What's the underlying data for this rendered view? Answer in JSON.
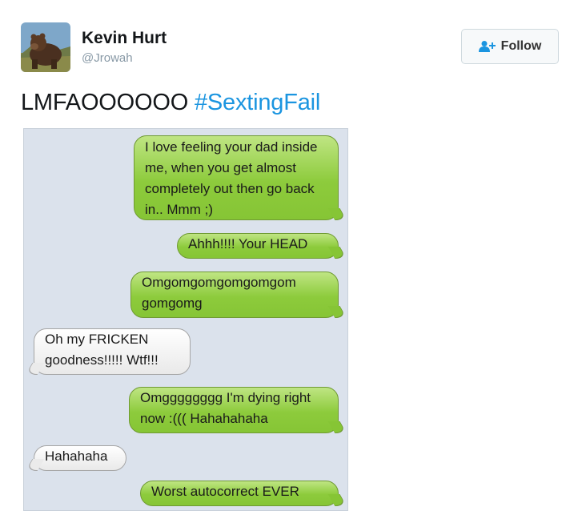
{
  "user": {
    "name": "Kevin Hurt",
    "handle": "@Jrowah",
    "avatar_icon": "bear-photo"
  },
  "follow_button": {
    "label": "Follow",
    "icon": "add-user-icon"
  },
  "tweet": {
    "text": "LMFAOOOOOO ",
    "hashtag": "#SextingFail"
  },
  "colors": {
    "hashtag": "#1b95e0",
    "outgoing_bubble": "#8dcb3c",
    "incoming_bubble": "#ffffff",
    "conversation_bg": "#dbe2ec"
  },
  "messages": [
    {
      "direction": "outgoing",
      "text": "I love feeling your dad inside me, when you get almost completely out then go back in.. Mmm ;)"
    },
    {
      "direction": "outgoing",
      "text": "Ahhh!!!! Your HEAD"
    },
    {
      "direction": "outgoing",
      "text": "Omgomgomgomgomgom gomgomg"
    },
    {
      "direction": "incoming",
      "text": "Oh my FRICKEN goodness!!!!! Wtf!!!"
    },
    {
      "direction": "outgoing",
      "text": "Omgggggggg I'm dying right now :((( Hahahahaha"
    },
    {
      "direction": "incoming",
      "text": "Hahahaha"
    },
    {
      "direction": "outgoing",
      "text": "Worst autocorrect EVER"
    }
  ]
}
